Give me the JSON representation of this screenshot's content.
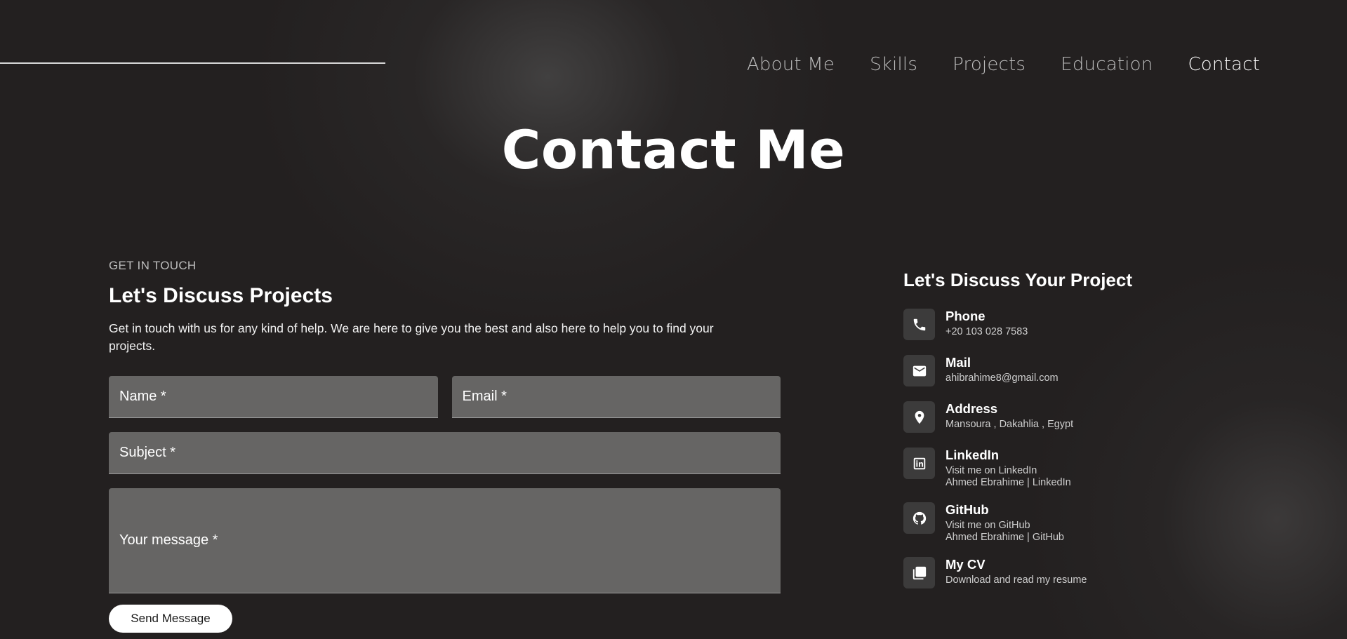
{
  "nav": {
    "items": [
      {
        "label": "About Me",
        "active": false
      },
      {
        "label": "Skills",
        "active": false
      },
      {
        "label": "Projects",
        "active": false
      },
      {
        "label": "Education",
        "active": false
      },
      {
        "label": "Contact",
        "active": true
      }
    ]
  },
  "page_title": "Contact Me",
  "form_section": {
    "eyebrow": "GET IN TOUCH",
    "heading": "Let's Discuss Projects",
    "intro": "Get in touch with us for any kind of help. We are here to give you the best and also here to help you to find your projects.",
    "fields": {
      "name": "Name *",
      "email": "Email *",
      "subject": "Subject *",
      "message": "Your message *"
    },
    "send_label": "Send Message"
  },
  "contact_section": {
    "heading": "Let's Discuss Your Project",
    "items": [
      {
        "icon": "phone-icon",
        "title": "Phone",
        "lines": [
          "+20 103 028 7583"
        ]
      },
      {
        "icon": "mail-icon",
        "title": "Mail",
        "lines": [
          "ahibrahime8@gmail.com"
        ]
      },
      {
        "icon": "location-pin-icon",
        "title": "Address",
        "lines": [
          "Mansoura , Dakahlia , Egypt"
        ]
      },
      {
        "icon": "linkedin-icon",
        "title": "LinkedIn",
        "lines": [
          "Visit me on LinkedIn",
          "Ahmed Ebrahime | LinkedIn"
        ]
      },
      {
        "icon": "github-icon",
        "title": "GitHub",
        "lines": [
          "Visit me on GitHub",
          "Ahmed Ebrahime | GitHub"
        ]
      },
      {
        "icon": "pdf-icon",
        "title": "My CV",
        "lines": [
          "Download and read my resume"
        ]
      }
    ]
  },
  "colors": {
    "background": "#232020",
    "field_background": "#666564",
    "icon_box": "#3c3b3b",
    "accent_white": "#ffffff",
    "nav_inactive": "#bdbdbd"
  }
}
